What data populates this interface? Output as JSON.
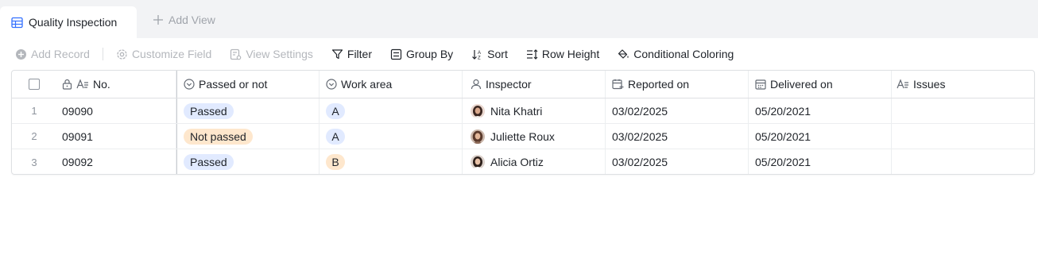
{
  "tabs": {
    "active_label": "Quality Inspection",
    "add_view_label": "Add View"
  },
  "toolbar": {
    "add_record": "Add Record",
    "customize_field": "Customize Field",
    "view_settings": "View Settings",
    "filter": "Filter",
    "group_by": "Group By",
    "sort": "Sort",
    "row_height": "Row Height",
    "conditional_coloring": "Conditional Coloring"
  },
  "columns": {
    "no": "No.",
    "passed": "Passed or not",
    "area": "Work area",
    "inspector": "Inspector",
    "reported": "Reported on",
    "delivered": "Delivered on",
    "issues": "Issues"
  },
  "rows": [
    {
      "idx": "1",
      "no": "09090",
      "passed": "Passed",
      "area": "A",
      "inspector": "Nita Khatri",
      "reported": "03/02/2025",
      "delivered": "05/20/2021",
      "issues": ""
    },
    {
      "idx": "2",
      "no": "09091",
      "passed": "Not passed",
      "area": "A",
      "inspector": "Juliette Roux",
      "reported": "03/02/2025",
      "delivered": "05/20/2021",
      "issues": ""
    },
    {
      "idx": "3",
      "no": "09092",
      "passed": "Passed",
      "area": "B",
      "inspector": "Alicia Ortiz",
      "reported": "03/02/2025",
      "delivered": "05/20/2021",
      "issues": ""
    }
  ],
  "colors": {
    "accent": "#3370ff",
    "tag_blue": "#e1eaff",
    "tag_orange": "#fee7cd"
  }
}
